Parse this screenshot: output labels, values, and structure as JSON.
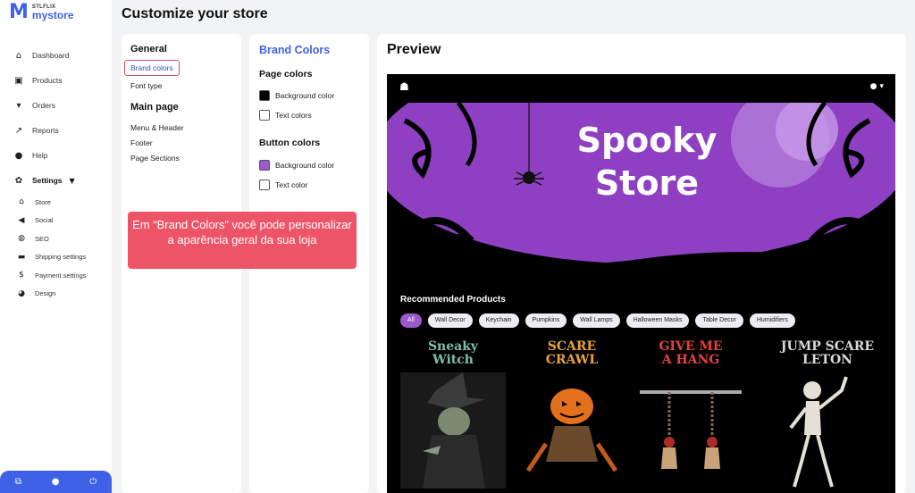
{
  "app": {
    "logo_small": "STLFLIX",
    "logo_big": "mystore"
  },
  "sidebar": {
    "items": [
      {
        "label": "Dashboard",
        "icon": "home-icon"
      },
      {
        "label": "Products",
        "icon": "box-icon"
      },
      {
        "label": "Orders",
        "icon": "cart-icon"
      },
      {
        "label": "Reports",
        "icon": "chart-icon"
      },
      {
        "label": "Help",
        "icon": "help-icon"
      },
      {
        "label": "Settings",
        "icon": "gear-icon"
      }
    ],
    "settings_sub": [
      {
        "label": "Store",
        "icon": "bank-icon"
      },
      {
        "label": "Social",
        "icon": "share-icon"
      },
      {
        "label": "SEO",
        "icon": "globe-icon"
      },
      {
        "label": "Shipping settings",
        "icon": "truck-icon"
      },
      {
        "label": "Payment settings",
        "icon": "dollar-icon"
      },
      {
        "label": "Design",
        "icon": "palette-icon"
      }
    ]
  },
  "page": {
    "title": "Customize your store"
  },
  "general_panel": {
    "general_heading": "General",
    "brand_colors_link": "Brand colors",
    "font_type_link": "Font type",
    "main_page_heading": "Main page",
    "menu_header_link": "Menu & Header",
    "footer_link": "Footer",
    "page_sections_link": "Page Sections"
  },
  "brand_panel": {
    "heading": "Brand Colors",
    "page_colors_heading": "Page colors",
    "page_bg_label": "Background color",
    "page_text_label": "Text colors",
    "button_colors_heading": "Button colors",
    "button_bg_label": "Background color",
    "button_text_label": "Text color",
    "colors": {
      "page_background": "#000000",
      "page_text": "#ffffff",
      "button_background": "#9b59c9",
      "button_text": "#ffffff"
    }
  },
  "tooltip": {
    "text": "Em “Brand Colors” você pode personalizar a aparência geral da sua loja"
  },
  "preview": {
    "heading": "Preview",
    "hero_line1": "Spooky",
    "hero_line2": "Store",
    "recommended_title": "Recommended Products",
    "chips": [
      "All",
      "Wall Decor",
      "Keychain",
      "Pumpkins",
      "Wall Lamps",
      "Halloween Masks",
      "Table Decor",
      "Humidifiers"
    ],
    "products": [
      {
        "title_line1": "Sneaky",
        "title_line2": "Witch",
        "color": "#7fbfa8"
      },
      {
        "title_line1": "SCARE",
        "title_line2": "CRAWL",
        "color": "#e8a23a"
      },
      {
        "title_line1": "GIVE ME",
        "title_line2": "A HANG",
        "color": "#e8413a"
      },
      {
        "title_line1": "JUMP SCARE",
        "title_line2": "LETON",
        "color": "#d9d9d9"
      }
    ]
  }
}
